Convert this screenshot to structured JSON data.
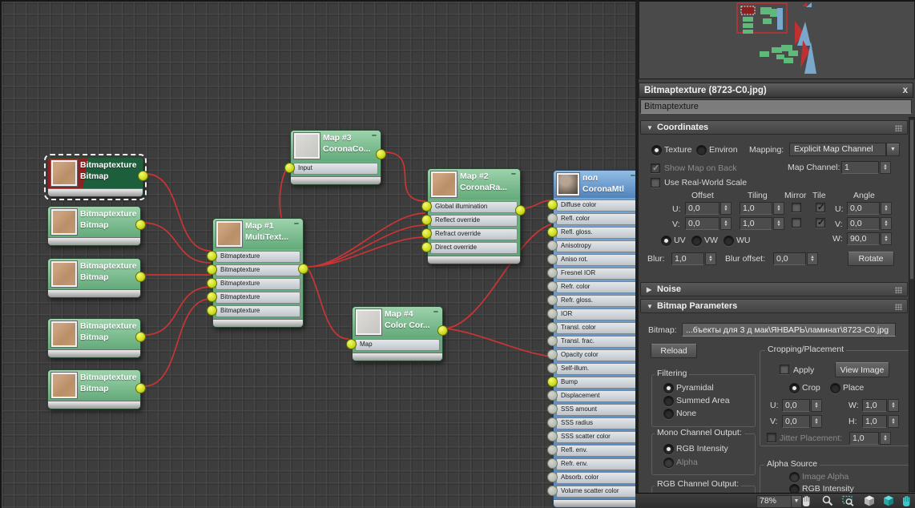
{
  "graph": {
    "bitmap_nodes": [
      {
        "title": "Bitmaptexture",
        "subtitle": "Bitmap"
      },
      {
        "title": "Bitmaptexture",
        "subtitle": "Bitmap"
      },
      {
        "title": "Bitmaptexture",
        "subtitle": "Bitmap"
      },
      {
        "title": "Bitmaptexture",
        "subtitle": "Bitmap"
      },
      {
        "title": "Bitmaptexture",
        "subtitle": "Bitmap"
      }
    ],
    "map_nodes": {
      "map1": {
        "title": "Map #1",
        "subtitle": "MultiText...",
        "slots": [
          "Bitmaptexture",
          "Bitmaptexture",
          "Bitmaptexture",
          "Bitmaptexture",
          "Bitmaptexture"
        ]
      },
      "map2": {
        "title": "Map #2",
        "subtitle": "CoronaRa...",
        "slots": [
          "Global illumination",
          "Reflect override",
          "Refract override",
          "Direct override"
        ]
      },
      "map3": {
        "title": "Map #3",
        "subtitle": "CoronaCo...",
        "slots": [
          "Input"
        ]
      },
      "map4": {
        "title": "Map #4",
        "subtitle": "Color Cor...",
        "slots": [
          "Map"
        ]
      }
    },
    "material_node": {
      "title": "пол",
      "subtitle": "CoronaMtl",
      "slots": [
        "Diffuse color",
        "Refl. color",
        "Refl. gloss.",
        "Anisotropy",
        "Aniso rot.",
        "Fresnel IOR",
        "Refr. color",
        "Refr. gloss.",
        "IOR",
        "Transl. color",
        "Transl. frac.",
        "Opacity color",
        "Self-illum.",
        "Bump",
        "Displacement",
        "SSS amount",
        "SSS radius",
        "SSS scatter color",
        "Refl. env.",
        "Refr. env.",
        "Absorb. color",
        "Volume scatter color"
      ]
    }
  },
  "panel": {
    "title": "Bitmaptexture (8723-C0.jpg)",
    "close_label": "x",
    "name_field": "Bitmaptexture",
    "coordinates": {
      "title": "Coordinates",
      "radio_texture": "Texture",
      "radio_environ": "Environ",
      "mapping_label": "Mapping:",
      "mapping_value": "Explicit Map Channel",
      "show_map_on_back": "Show Map on Back",
      "map_channel_label": "Map Channel:",
      "map_channel_value": "1",
      "use_real_world_scale": "Use Real-World Scale",
      "offset_label": "Offset",
      "tiling_label": "Tiling",
      "mirror_label": "Mirror",
      "tile_label": "Tile",
      "angle_label": "Angle",
      "u_label": "U:",
      "v_label": "V:",
      "w_label": "W:",
      "offset_u": "0,0",
      "offset_v": "0,0",
      "tiling_u": "1,0",
      "tiling_v": "1,0",
      "angle_u": "0,0",
      "angle_v": "0,0",
      "angle_w": "90,0",
      "radio_uv": "UV",
      "radio_vw": "VW",
      "radio_wu": "WU",
      "blur_label": "Blur:",
      "blur_value": "1,0",
      "blur_offset_label": "Blur offset:",
      "blur_offset_value": "0,0",
      "rotate_button": "Rotate"
    },
    "noise": {
      "title": "Noise"
    },
    "bitmap_parameters": {
      "title": "Bitmap Parameters",
      "bitmap_label": "Bitmap:",
      "bitmap_path": "...бъекты для 3 д мак\\ЯНВАРЬ\\ламинат\\8723-C0.jpg",
      "reload_button": "Reload",
      "cropping_title": "Cropping/Placement",
      "apply_label": "Apply",
      "view_image_button": "View Image",
      "crop_label": "Crop",
      "place_label": "Place",
      "crop_u_label": "U:",
      "crop_u": "0,0",
      "crop_w_label": "W:",
      "crop_w": "1,0",
      "crop_v_label": "V:",
      "crop_v": "0,0",
      "crop_h_label": "H:",
      "crop_h": "1,0",
      "jitter_label": "Jitter Placement:",
      "jitter_value": "1,0",
      "filtering": {
        "title": "Filtering",
        "options": [
          "Pyramidal",
          "Summed Area",
          "None"
        ]
      },
      "mono_channel": {
        "title": "Mono Channel Output:",
        "options": [
          "RGB Intensity",
          "Alpha"
        ]
      },
      "rgb_channel": {
        "title": "RGB Channel Output:"
      },
      "alpha_source": {
        "title": "Alpha Source",
        "options": [
          "Image Alpha",
          "RGB Intensity"
        ]
      }
    }
  },
  "statusbar": {
    "zoom_level": "78%",
    "icons": [
      "pan-hand",
      "zoom-magnifier",
      "zoom-region",
      "zoom-extents",
      "zoom-extents-selected",
      "pan-to-selected"
    ]
  },
  "colors": {
    "wire_red": "#cb3434",
    "socket_yellow": "#cddb1d",
    "map_node_green": "#6fb986",
    "material_node_blue": "#5d93c9",
    "selection_red": "#8a1c1c",
    "panel_bg": "#414141"
  }
}
